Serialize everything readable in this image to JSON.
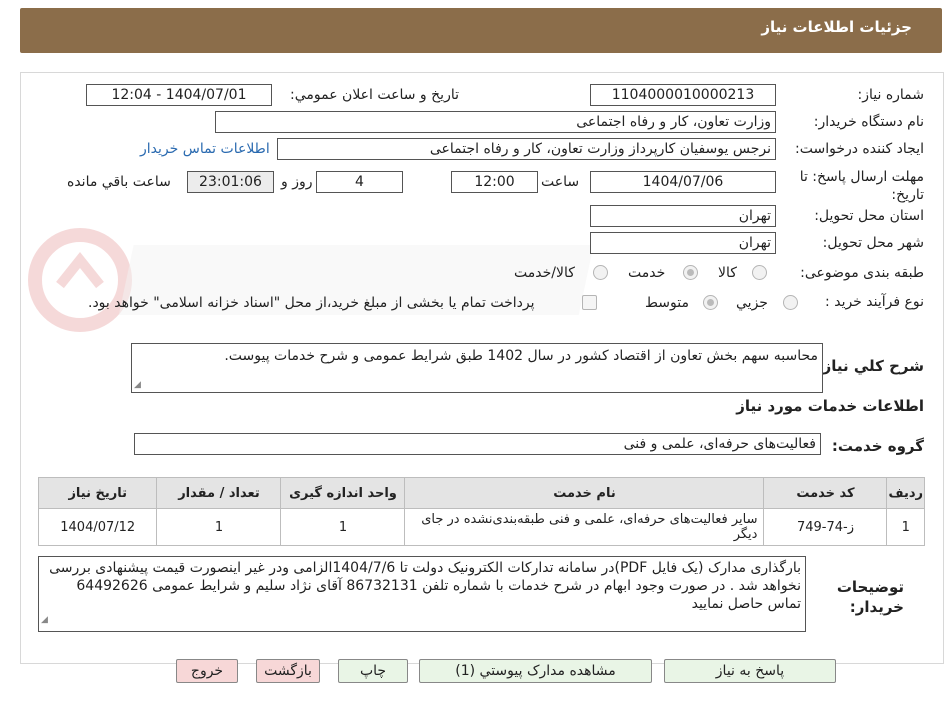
{
  "header": {
    "title": "جزئيات اطلاعات نياز"
  },
  "fields": {
    "need_number_label": "شماره نياز:",
    "need_number": "1104000010000213",
    "announce_label": "تاريخ و ساعت اعلان عمومي:",
    "announce_value": "1404/07/01 - 12:04",
    "buyer_org_label": "نام دستگاه خريدار:",
    "buyer_org": "وزارت تعاون، کار و رفاه اجتماعی",
    "requester_label": "ايجاد کننده درخواست:",
    "requester": "نرجس یوسفیان کارپرداز وزارت تعاون، کار و رفاه اجتماعی",
    "contact_link": "اطلاعات تماس خريدار",
    "deadline_label": "مهلت ارسال پاسخ: تا تاريخ:",
    "deadline_date": "1404/07/06",
    "time_label": "ساعت",
    "deadline_time": "12:00",
    "days_value": "4",
    "days_label": "روز و",
    "remaining_time": "23:01:06",
    "remaining_label": "ساعت باقي مانده",
    "province_label": "استان محل تحويل:",
    "province": "تهران",
    "city_label": "شهر محل تحويل:",
    "city": "تهران",
    "category_label": "طبقه بندی موضوعی:",
    "category_options": [
      "کالا",
      "خدمت",
      "کالا/خدمت"
    ],
    "purchase_type_label": "نوع فرآيند خريد :",
    "purchase_options": [
      "جزيي",
      "متوسط"
    ],
    "payment_note": "پرداخت تمام یا بخشی از مبلغ خرید،از محل \"اسناد خزانه اسلامی\" خواهد بود."
  },
  "description": {
    "label": "شرح کلي نياز:",
    "text": "محاسبه سهم بخش تعاون از اقتصاد کشور در سال 1402 طبق شرایط عمومی و شرح خدمات پیوست."
  },
  "services": {
    "section_title": "اطلاعات خدمات مورد نياز",
    "group_label": "گروه خدمت:",
    "group_value": "فعالیت‌های حرفه‌ای، علمی و فنی",
    "columns": [
      "رديف",
      "کد خدمت",
      "نام خدمت",
      "واحد اندازه گيری",
      "تعداد / مقدار",
      "تاريخ نياز"
    ],
    "rows": [
      [
        "1",
        "ز-74-749",
        "سایر فعالیت‌های حرفه‌ای، علمی و فنی طبقه‌بندی‌نشده در جای دیگر",
        "1",
        "1",
        "1404/07/12"
      ]
    ]
  },
  "buyer_notes": {
    "label": "توضيحات خريدار:",
    "text": "بارگذاری مدارک (یک فایل PDF)در سامانه تدارکات الکترونیک دولت تا 1404/7/6الزامی ودر غیر اینصورت قیمت پیشنهادی بررسی نخواهد شد . در صورت وجود ابهام در شرح خدمات با شماره تلفن 86732131 آقای نژاد سلیم و شرایط عمومی 64492626 تماس حاصل نمایید"
  },
  "buttons": {
    "reply": "پاسخ به نياز",
    "view_docs": "مشاهده مدارک پيوستي (1)",
    "print": "چاپ",
    "back": "بازگشت",
    "exit": "خروج"
  },
  "colors": {
    "header": "#8b6d4a",
    "button_green": "#e9f5e6",
    "button_red": "#f7d7d7"
  }
}
